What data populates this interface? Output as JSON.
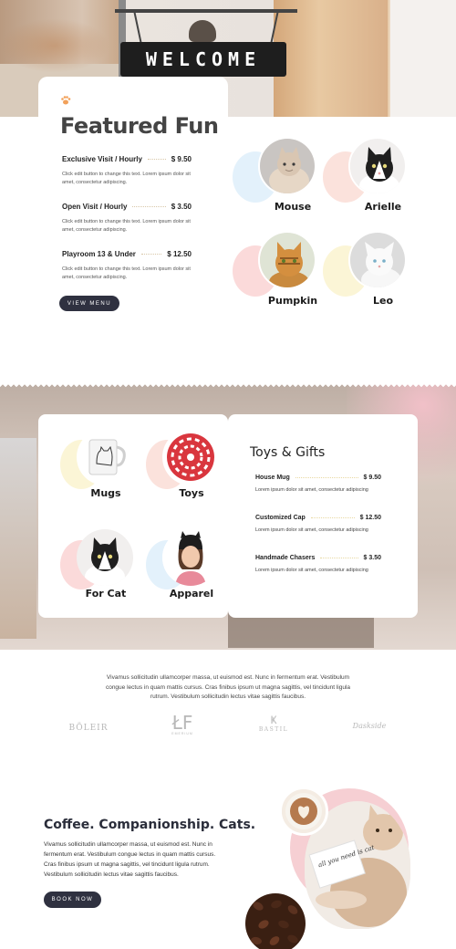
{
  "hero": {
    "sign_text": "WELCOME"
  },
  "featured": {
    "title": "Featured Fun",
    "items": [
      {
        "name": "Exclusive Visit / Hourly",
        "price": "$ 9.50",
        "desc": "Click edit button to change this text. Lorem ipsum dolor sit amet, consectetur adipiscing."
      },
      {
        "name": "Open Visit / Hourly",
        "price": "$ 3.50",
        "desc": "Click edit button to change this text. Lorem ipsum dolor sit amet, consectetur adipiscing."
      },
      {
        "name": "Playroom 13 & Under",
        "price": "$ 12.50",
        "desc": "Click edit button to change this text. Lorem ipsum dolor sit amet, consectetur adipiscing."
      }
    ],
    "button_label": "VIEW MENU"
  },
  "cats": [
    {
      "name": "Mouse",
      "blob_color": "#e3f1fb"
    },
    {
      "name": "Arielle",
      "blob_color": "#fbe2dc"
    },
    {
      "name": "Pumpkin",
      "blob_color": "#fbdada"
    },
    {
      "name": "Leo",
      "blob_color": "#fbf5d6"
    }
  ],
  "shop": {
    "title": "Toys & Gifts",
    "items": [
      {
        "name": "House Mug",
        "price": "$ 9.50",
        "desc": "Lorem ipsum dolor sit amet, consectetur adipiscing"
      },
      {
        "name": "Customized Cap",
        "price": "$ 12.50",
        "desc": "Lorem ipsum dolor sit amet, consectetur adipiscing"
      },
      {
        "name": "Handmade Chasers",
        "price": "$ 3.50",
        "desc": "Lorem ipsum dolor sit amet, consectetur adipiscing"
      }
    ],
    "products": [
      {
        "name": "Mugs",
        "blob_color": "#fbf5d6"
      },
      {
        "name": "Toys",
        "blob_color": "#fbe2dc"
      },
      {
        "name": "For Cat",
        "blob_color": "#fbdada"
      },
      {
        "name": "Apparel",
        "blob_color": "#e3f1fb"
      }
    ]
  },
  "partners": {
    "text": "Vivamus sollicitudin ullamcorper massa, ut euismod est. Nunc in fermentum erat. Vestibulum congue lectus in quam mattis cursus. Cras finibus ipsum ut magna sagittis, vel tincidunt ligula rutrum. Vestibulum sollicitudin lectus vitae sagittis faucibus.",
    "logos": [
      "BÖLEIR",
      "EMERIUM",
      "BASTIL",
      "Daskside"
    ]
  },
  "about": {
    "title": "Coffee. Companionship. Cats.",
    "body": "Vivamus sollicitudin ullamcorper massa, ut euismod est. Nunc in fermentum erat. Vestibulum congue lectus in quam mattis cursus. Cras finibus ipsum ut magna sagittis, vel tincidunt ligula rutrum. Vestibulum sollicitudin lectus vitae sagittis faucibus.",
    "button_label": "BOOK NOW",
    "note_text": "all you need is cat"
  }
}
